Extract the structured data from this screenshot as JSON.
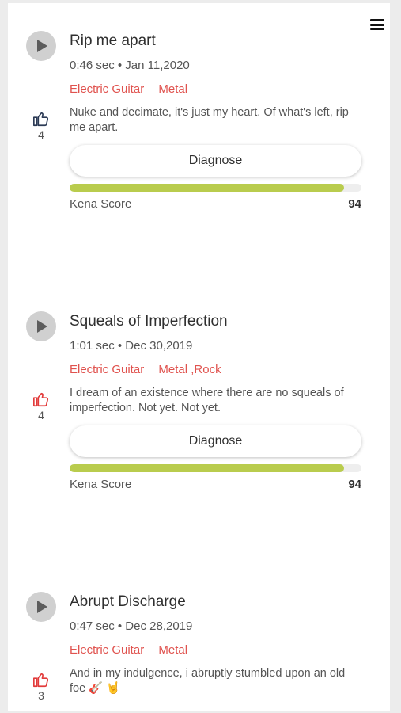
{
  "tracks": [
    {
      "title": "Rip me apart",
      "meta": "0:46 sec • Jan 11,2020",
      "tags": [
        "Electric Guitar",
        "Metal"
      ],
      "description": "Nuke and decimate, it's just my heart. Of what's left, rip me apart.",
      "likes": "4",
      "liked": false,
      "diagnose_label": "Diagnose",
      "score_label": "Kena Score",
      "score": "94"
    },
    {
      "title": "Squeals of Imperfection",
      "meta": "1:01 sec • Dec 30,2019",
      "tags": [
        "Electric Guitar",
        "Metal ,Rock"
      ],
      "description": "I dream of an existence where there are no squeals of imperfection. Not yet. Not yet.",
      "likes": "4",
      "liked": true,
      "diagnose_label": "Diagnose",
      "score_label": "Kena Score",
      "score": "94"
    },
    {
      "title": "Abrupt Discharge",
      "meta": "0:47 sec • Dec 28,2019",
      "tags": [
        "Electric Guitar",
        "Metal"
      ],
      "description": "And in my indulgence, i abruptly stumbled upon an old foe 🎸 🤘",
      "likes": "3",
      "liked": true
    }
  ],
  "colors": {
    "tag": "#e0534f",
    "like_active": "#e23b3b",
    "like_inactive": "#2b3a55",
    "score_bar": "#b9cc4d"
  },
  "icons": {
    "menu": "hamburger-menu-icon",
    "play": "play-icon",
    "like": "thumbs-up-icon"
  }
}
